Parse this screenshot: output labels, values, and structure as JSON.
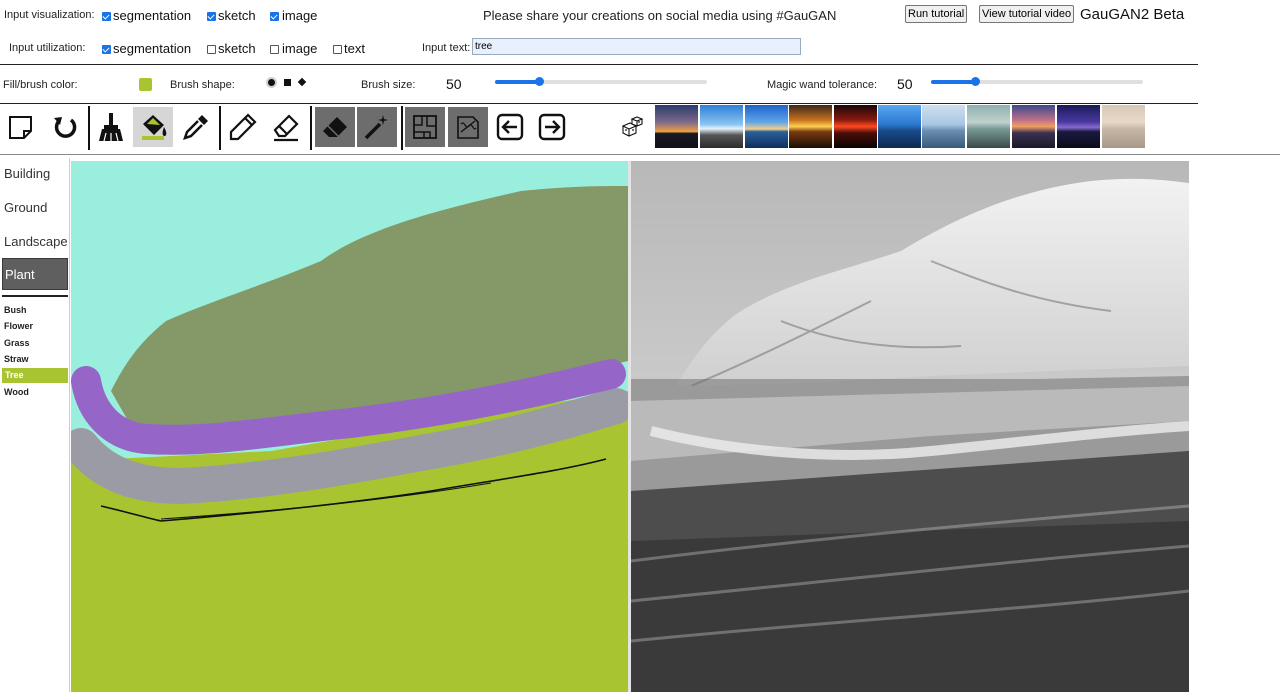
{
  "input_visualization": {
    "label": "Input visualization:",
    "options": [
      {
        "label": "segmentation",
        "checked": true
      },
      {
        "label": "sketch",
        "checked": true
      },
      {
        "label": "image",
        "checked": true
      }
    ]
  },
  "input_utilization": {
    "label": "Input utilization:",
    "options": [
      {
        "label": "segmentation",
        "checked": true
      },
      {
        "label": "sketch",
        "checked": false
      },
      {
        "label": "image",
        "checked": false
      },
      {
        "label": "text",
        "checked": false
      }
    ]
  },
  "banner": "Please share your creations on social media using #GauGAN",
  "run_tutorial": "Run tutorial",
  "view_tutorial_video": "View tutorial video",
  "app_title": "GauGAN2 Beta",
  "input_text": {
    "label": "Input text:",
    "value": "tree"
  },
  "controls": {
    "fill_color_label": "Fill/brush color:",
    "fill_color": "#a8c531",
    "brush_shape_label": "Brush shape:",
    "brush_size_label": "Brush size:",
    "brush_size_value": "50",
    "brush_size_fraction": 0.21,
    "magic_wand_label": "Magic wand tolerance:",
    "magic_wand_value": "50",
    "magic_wand_fraction": 0.21
  },
  "tools": [
    {
      "name": "new-canvas-icon",
      "state": "none"
    },
    {
      "name": "undo-icon",
      "state": "none"
    },
    {
      "name": "broom-icon",
      "state": "none"
    },
    {
      "name": "paint-bucket-icon",
      "state": "light"
    },
    {
      "name": "eyedropper-icon",
      "state": "none"
    },
    {
      "name": "pencil-icon",
      "state": "none"
    },
    {
      "name": "sketch-eraser-icon",
      "state": "none"
    },
    {
      "name": "eraser-icon",
      "state": "dark"
    },
    {
      "name": "magic-wand-icon",
      "state": "dark"
    },
    {
      "name": "segmentation-map-icon",
      "state": "dark"
    },
    {
      "name": "sketch-map-icon",
      "state": "dark"
    },
    {
      "name": "arrow-left-icon",
      "state": "none"
    },
    {
      "name": "arrow-right-icon",
      "state": "none"
    },
    {
      "name": "random-dice-icon",
      "state": "none"
    }
  ],
  "categories": [
    {
      "label": "Building",
      "selected": false
    },
    {
      "label": "Ground",
      "selected": false
    },
    {
      "label": "Landscape",
      "selected": false
    },
    {
      "label": "Plant",
      "selected": true
    }
  ],
  "subcategories": [
    {
      "label": "Bush",
      "selected": false
    },
    {
      "label": "Flower",
      "selected": false
    },
    {
      "label": "Grass",
      "selected": false
    },
    {
      "label": "Straw",
      "selected": false
    },
    {
      "label": "Tree",
      "selected": true
    },
    {
      "label": "Wood",
      "selected": false
    }
  ],
  "colors": {
    "sky": "#9aeede",
    "mountain": "#859868",
    "purple": "#9566c8",
    "gray": "#9a9ba5",
    "grass": "#a8c531",
    "accent": "#1a73e8"
  }
}
